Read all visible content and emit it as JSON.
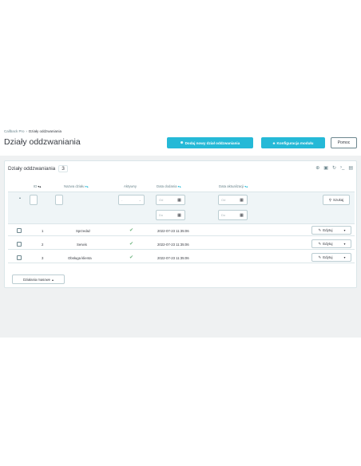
{
  "breadcrumb": [
    "Callback Pro",
    "Działy oddzwaniania"
  ],
  "page_title": "Działy oddzwaniania",
  "toolbar": {
    "add_label": "Dodaj nowy dział oddzwaniania",
    "config_label": "Konfiguracja modułu",
    "help_label": "Pomoc"
  },
  "panel": {
    "title": "Działy oddzwaniania",
    "count": "3",
    "tools": [
      "add-icon",
      "export-icon",
      "refresh-icon",
      "sql-icon",
      "database-icon"
    ]
  },
  "columns": {
    "id": "ID",
    "name": "Nazwa działu",
    "active": "Aktywny",
    "date_add": "Data dodania",
    "date_upd": "Data aktualizacji"
  },
  "filters": {
    "active_select": "-",
    "from_placeholder": "Od",
    "to_placeholder": "Do",
    "search_label": "Szukaj"
  },
  "rows": [
    {
      "id": "1",
      "name": "Sprzedaż",
      "date_add": "2022-07-23 11:35:06",
      "edit_label": "Edytuj"
    },
    {
      "id": "2",
      "name": "Serwis",
      "date_add": "2022-07-23 11:35:06",
      "edit_label": "Edytuj"
    },
    {
      "id": "3",
      "name": "Obsługa klienta",
      "date_add": "2022-07-23 11:35:06",
      "edit_label": "Edytuj"
    }
  ],
  "bulk_label": "Działania masowe",
  "colors": {
    "accent": "#25b9d7",
    "success": "#70b580",
    "text": "#363a41"
  }
}
